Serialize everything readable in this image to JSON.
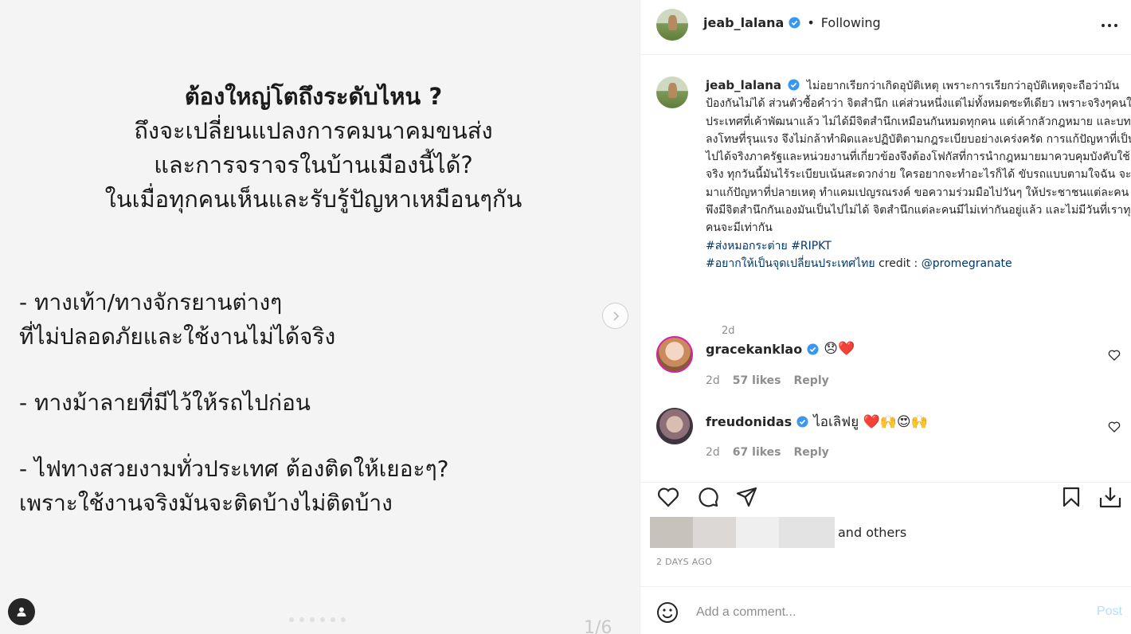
{
  "media": {
    "title_bold": "ต้องใหญ่โตถึงระดับไหน ?",
    "title_lines": [
      "ถึงจะเปลี่ยนแปลงการคมนาคมขนส่ง",
      "และการจราจรในบ้านเมืองนี้ได้?",
      "ในเมื่อทุกคนเห็นและรับรู้ปัญหาเหมือนๆกัน"
    ],
    "bullets": [
      [
        "- ทางเท้า/ทางจักรยานต่างๆ",
        "ที่ไม่ปลอดภัยและใช้งานไม่ได้จริง"
      ],
      [
        "- ทางม้าลายที่มีไว้ให้รถไปก่อน"
      ],
      [
        "- ไฟทางสวยงามทั่วประเทศ ต้องติดให้เยอะๆ?",
        "เพราะใช้งานจริงมันจะติดบ้างไม่ติดบ้าง"
      ]
    ],
    "counter": "1/6",
    "icons": {
      "next": "chevron-right-icon",
      "tags": "user-icon"
    }
  },
  "header": {
    "username": "jeab_lalana",
    "separator": "•",
    "follow_status": "Following",
    "icons": {
      "verified": "verified-badge-icon",
      "more": "more-options-icon"
    }
  },
  "caption": {
    "username": "jeab_lalana",
    "text": "ไม่อยากเรียกว่าเกิดอุบัติเหตุ เพราะการเรียกว่าอุบัติเหตุจะถือว่ามันป้องกันไม่ได้ ส่วนตัวซื้อคำว่า จิตสำนึก แค่ส่วนหนึ่งแต่ไม่ทั้งหมดซะทีเดียว เพราะจริงๆคนในประเทศที่เค้าพัฒนาแล้ว ไม่ได้มีจิตสำนึกเหมือนกันหมดทุกคน แต่เค้ากลัวกฎหมาย และบทลงโทษที่รุนแรง จึงไม่กล้าทำผิดและปฏิบัติตามกฎระเบียบอย่างเคร่งครัด การแก้ปัญหาที่เป็นไปได้จริงภาครัฐและหน่วยงานที่เกี่ยวข้องจึงต้องโฟกัสที่การนำกฎหมายมาควบคุมบังคับใช้จริง ทุกวันนี้มันไร้ระเบียบเน้นสะดวกง่าย ใครอยากจะทำอะไรก็ได้ ขับรถแบบตามใจฉัน จะมาแก้ปัญหาที่ปลายเหตุ ทำแคมเปญรณรงค์ ขอความร่วมมือไปวันๆ ให้ประชาชนแต่ละคนพึงมีจิตสำนึกกันเองมันเป็นไปไม่ได้ จิตสำนึกแต่ละคนมีไม่เท่ากันอยู่แล้ว และไม่มีวันที่เราทุกคนจะมีเท่ากัน",
    "hashtags_line1": [
      "#ส่งหมอกระต่าย",
      "#RIPKT"
    ],
    "hashtag_line2": "#อยากให้เป็นจุดเปลี่ยนประเทศไทย",
    "credit_label": "credit :",
    "credit_handle": "@promegranate",
    "time": "2d"
  },
  "comments": [
    {
      "username": "gracekanklao",
      "text": "😞❤️",
      "time": "2d",
      "likes": "57 likes",
      "reply": "Reply"
    },
    {
      "username": "freudonidas",
      "text": "ไอเลิฟยู ❤️🙌😍🙌",
      "time": "2d",
      "likes": "67 likes",
      "reply": "Reply"
    }
  ],
  "actions": {
    "icons": [
      "like-icon",
      "comment-icon",
      "share-icon",
      "save-icon",
      "download-icon"
    ],
    "liked_by_suffix": "and others",
    "timestamp": "2 DAYS AGO"
  },
  "comment_box": {
    "placeholder": "Add a comment...",
    "post_label": "Post",
    "post_color": "#b2dffc",
    "icons": {
      "emoji": "emoji-icon"
    }
  },
  "colors": {
    "verified": "#3897f0",
    "hashtag": "#00376b",
    "muted": "#8e8e8e"
  }
}
